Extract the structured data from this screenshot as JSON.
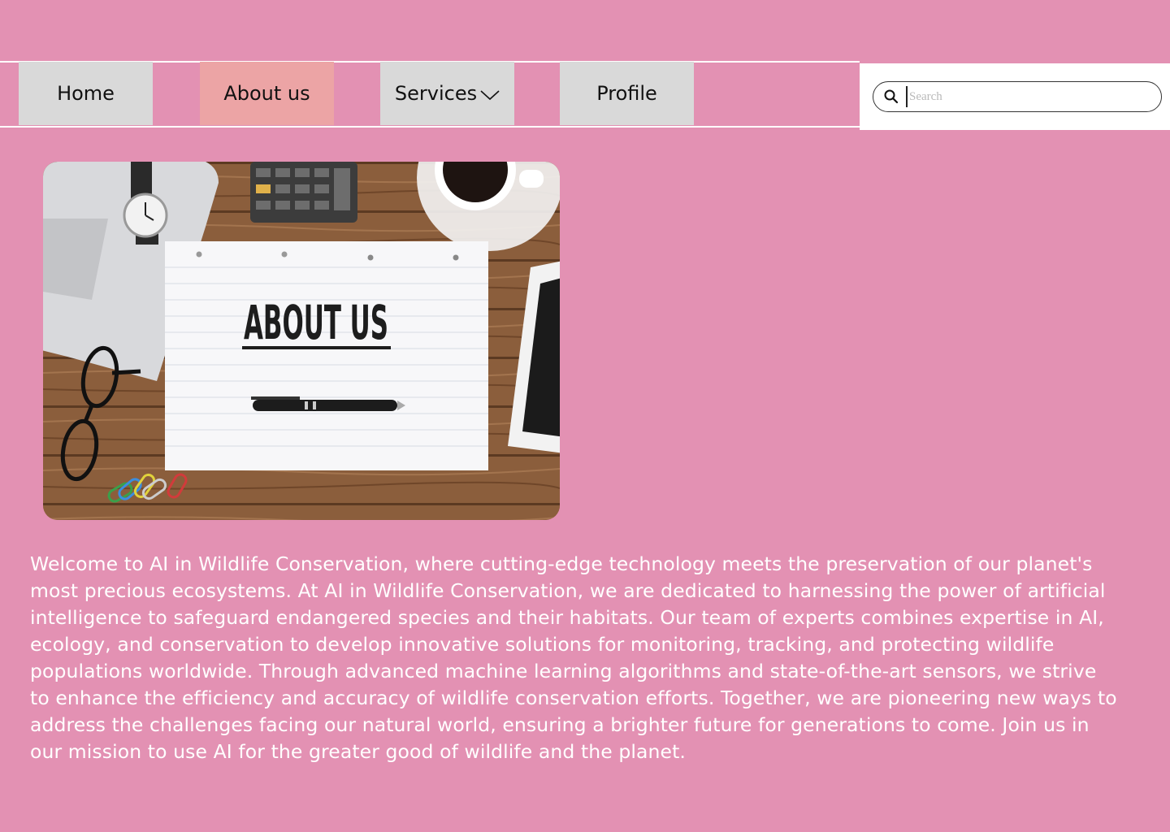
{
  "nav": {
    "items": [
      {
        "label": "Home"
      },
      {
        "label": "About us"
      },
      {
        "label": "Services"
      },
      {
        "label": "Profile"
      }
    ]
  },
  "search": {
    "placeholder": "Search",
    "icon": "search-icon"
  },
  "hero": {
    "title_text": "ABOUT US"
  },
  "about": {
    "body": "Welcome to AI in Wildlife Conservation, where cutting-edge technology meets the preservation of our planet's most precious ecosystems. At AI in Wildlife Conservation, we are dedicated to harnessing the power of artificial intelligence to safeguard endangered species and their habitats. Our team of experts combines expertise in AI, ecology, and conservation to develop innovative solutions for monitoring, tracking, and protecting wildlife populations worldwide. Through advanced machine learning algorithms and state-of-the-art sensors, we strive to enhance the efficiency and accuracy of wildlife conservation efforts. Together, we are pioneering new ways to address the challenges facing our natural world, ensuring a brighter future for generations to come. Join us in our mission to use AI for the greater good of wildlife and the planet."
  },
  "colors": {
    "page_bg": "#e391b3",
    "active_tab": "#eca4a5",
    "tab_bg": "#d9d9d9"
  }
}
